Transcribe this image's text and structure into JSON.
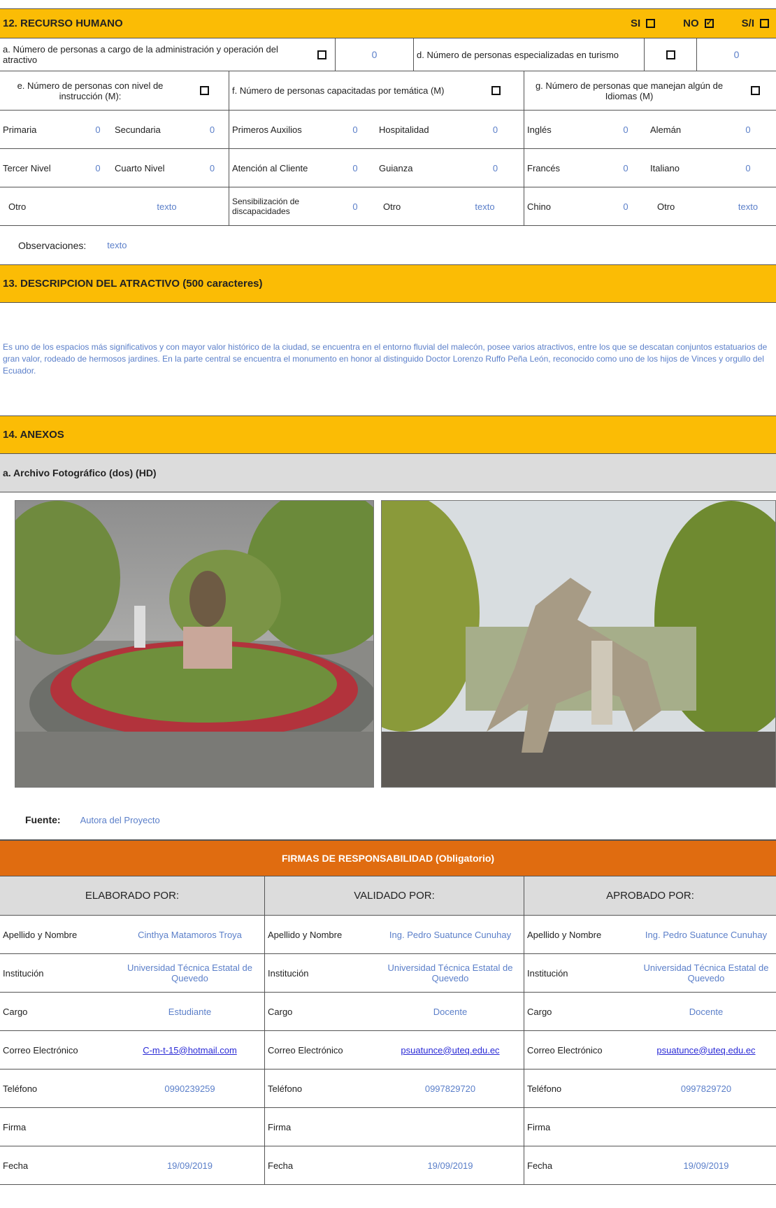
{
  "s12": {
    "title": "12. RECURSO HUMANO",
    "si": "SI",
    "no": "NO",
    "sn": "S/I",
    "a_label": "a. Número de personas a cargo de la administración y operación del atractivo",
    "a_val": "0",
    "d_label": "d. Número de personas especializadas en turismo",
    "d_val": "0",
    "e_label": "e. Número de personas con nivel de instrucción (M):",
    "f_label": "f. Número de personas capacitadas por temática (M)",
    "g_label": "g. Número de personas que manejan algún de Idiomas (M)",
    "r1": [
      "Primaria",
      "0",
      "Secundaria",
      "0",
      "Primeros Auxilios",
      "0",
      "Hospitalidad",
      "0",
      "Inglés",
      "0",
      "Alemán",
      "0"
    ],
    "r2": [
      "Tercer Nivel",
      "0",
      "Cuarto Nivel",
      "0",
      "Atención al Cliente",
      "0",
      "Guianza",
      "0",
      "Francés",
      "0",
      "Italiano",
      "0"
    ],
    "r3": [
      "Otro",
      "texto",
      "Sensibilización de discapacidades",
      "0",
      "Otro",
      "texto",
      "Chino",
      "0",
      "Otro",
      "texto"
    ],
    "obs_label": "Observaciones:",
    "obs_val": "texto"
  },
  "s13": {
    "title": "13. DESCRIPCION DEL ATRACTIVO (500 caracteres)",
    "text": "Es uno de los espacios más significativos y con mayor valor histórico de la ciudad, se encuentra en el entorno fluvial del malecón, posee varios atractivos, entre los que se descatan conjuntos estatuarios de gran valor, rodeado de hermosos jardines. En la parte central se encuentra el monumento en honor al distinguido Doctor Lorenzo Ruffo Peña León, reconocido como uno de los hijos de Vinces y orgullo del Ecuador."
  },
  "s14": {
    "title": "14. ANEXOS",
    "sub": "a. Archivo Fotográfico (dos) (HD)",
    "fuente_label": "Fuente:",
    "fuente_val": "Autora del Proyecto"
  },
  "firmas": {
    "title": "FIRMAS DE RESPONSABILIDAD (Obligatorio)",
    "cols": [
      "ELABORADO POR:",
      "VALIDADO  POR:",
      "APROBADO POR:"
    ],
    "labels": [
      "Apellido y Nombre",
      "Institución",
      "Cargo",
      "Correo Electrónico",
      "Teléfono",
      "Firma",
      "Fecha"
    ],
    "c1": [
      "Cinthya Matamoros Troya",
      "Universidad Técnica Estatal de Quevedo",
      "Estudiante",
      "C-m-t-15@hotmail.com",
      "0990239259",
      "",
      "19/09/2019"
    ],
    "c2": [
      "Ing. Pedro Suatunce Cunuhay",
      "Universidad Técnica Estatal de Quevedo",
      "Docente",
      "psuatunce@uteq.edu.ec",
      "0997829720",
      "",
      "19/09/2019"
    ],
    "c3": [
      "Ing. Pedro Suatunce Cunuhay",
      "Universidad Técnica Estatal de Quevedo",
      "Docente",
      "psuatunce@uteq.edu.ec",
      "0997829720",
      "",
      "19/09/2019"
    ]
  },
  "colors": {
    "header": "#fbbc05",
    "firmas": "#e06c10",
    "value": "#5b7fc9",
    "grey": "#dcdcdc"
  }
}
